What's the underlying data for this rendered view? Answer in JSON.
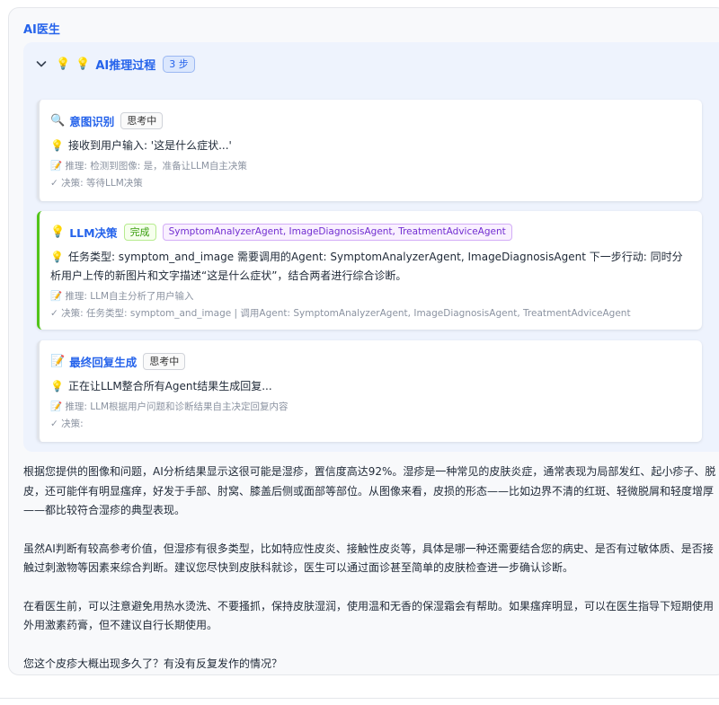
{
  "sender": "AI医生",
  "reasoning": {
    "header_emoji_1": "💡",
    "header_emoji_2": "💡",
    "title": "AI推理过程",
    "steps_badge": "3 步",
    "steps": [
      {
        "emoji": "🔍",
        "title": "意图识别",
        "status": "思考中",
        "content_emoji": "💡",
        "content": "接收到用户输入: '这是什么症状...'",
        "reasoning": "📝 推理: 检测到图像: 是，准备让LLM自主决策",
        "decision": "✓ 决策: 等待LLM决策"
      },
      {
        "emoji": "💡",
        "title": "LLM决策",
        "status": "完成",
        "agents": "SymptomAnalyzerAgent, ImageDiagnosisAgent, TreatmentAdviceAgent",
        "content_emoji": "💡",
        "content": "任务类型: symptom_and_image 需要调用的Agent: SymptomAnalyzerAgent, ImageDiagnosisAgent 下一步行动: 同时分析用户上传的新图片和文字描述“这是什么症状”，结合两者进行综合诊断。",
        "reasoning": "📝 推理: LLM自主分析了用户输入",
        "decision": "✓ 决策: 任务类型: symptom_and_image | 调用Agent: SymptomAnalyzerAgent, ImageDiagnosisAgent, TreatmentAdviceAgent"
      },
      {
        "emoji": "📝",
        "title": "最终回复生成",
        "status": "思考中",
        "content_emoji": "💡",
        "content": "正在让LLM整合所有Agent结果生成回复...",
        "reasoning": "📝 推理: LLM根据用户问题和诊断结果自主决定回复内容",
        "decision": "✓ 决策:"
      }
    ]
  },
  "answer": {
    "paragraphs": [
      "根据您提供的图像和问题，AI分析结果显示这很可能是湿疹，置信度高达92%。湿疹是一种常见的皮肤炎症，通常表现为局部发红、起小疹子、脱皮，还可能伴有明显瘙痒，好发于手部、肘窝、膝盖后侧或面部等部位。从图像来看，皮损的形态——比如边界不清的红斑、轻微脱屑和轻度增厚——都比较符合湿疹的典型表现。",
      "虽然AI判断有较高参考价值，但湿疹有很多类型，比如特应性皮炎、接触性皮炎等，具体是哪一种还需要结合您的病史、是否有过敏体质、是否接触过刺激物等因素来综合判断。建议您尽快到皮肤科就诊，医生可以通过面诊甚至简单的皮肤检查进一步确认诊断。",
      "在看医生前，可以注意避免用热水烫洗、不要搔抓，保持皮肤湿润，使用温和无香的保湿霜会有帮助。如果瘙痒明显，可以在医生指导下短期使用外用激素药膏，但不建议自行长期使用。",
      "您这个皮疹大概出现多久了？有没有反复发作的情况？"
    ]
  }
}
